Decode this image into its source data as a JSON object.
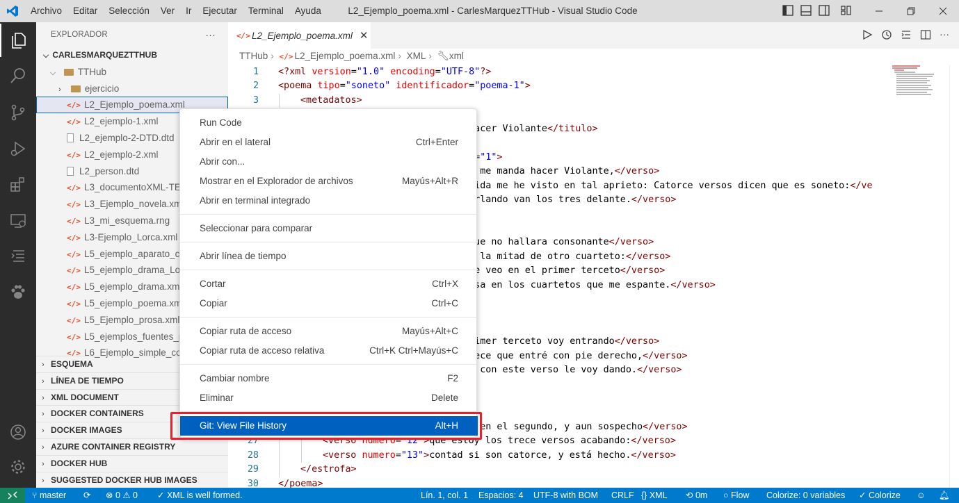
{
  "titlebar": {
    "menu": [
      "Archivo",
      "Editar",
      "Selección",
      "Ver",
      "Ir",
      "Ejecutar",
      "Terminal",
      "Ayuda"
    ],
    "window_title": "L2_Ejemplo_poema.xml - CarlesMarquezTTHub - Visual Studio Code"
  },
  "sidebar": {
    "title": "EXPLORADOR",
    "more": "···",
    "root": "CARLESMARQUEZTTHUB",
    "folder": "TTHub",
    "subfolder": "ejercicio",
    "files": [
      {
        "name": "L2_Ejemplo_poema.xml",
        "type": "xml"
      },
      {
        "name": "L2_ejemplo-1.xml",
        "type": "xml"
      },
      {
        "name": "L2_ejemplo-2-DTD.dtd",
        "type": "file"
      },
      {
        "name": "L2_ejemplo-2.xml",
        "type": "xml"
      },
      {
        "name": "L2_person.dtd",
        "type": "file"
      },
      {
        "name": "L3_documentoXML-TE",
        "type": "xml"
      },
      {
        "name": "L3_Ejemplo_novela.xm",
        "type": "xml"
      },
      {
        "name": "L3_mi_esquema.rng",
        "type": "xml"
      },
      {
        "name": "L3-Ejemplo_Lorca.xml",
        "type": "xml"
      },
      {
        "name": "L5_ejemplo_aparato_cu",
        "type": "xml"
      },
      {
        "name": "L5_ejemplo_drama_Lop",
        "type": "xml"
      },
      {
        "name": "L5_ejemplo_drama.xm",
        "type": "xml"
      },
      {
        "name": "L5_ejemplo_poema.xm",
        "type": "xml"
      },
      {
        "name": "L5_Ejemplo_prosa.xml",
        "type": "xml"
      },
      {
        "name": "L5_ejemplos_fuentes_p",
        "type": "xml"
      },
      {
        "name": "L6_Ejemplo_simple_co",
        "type": "xml"
      }
    ],
    "panels": [
      "ESQUEMA",
      "LÍNEA DE TIEMPO",
      "XML DOCUMENT",
      "DOCKER CONTAINERS",
      "DOCKER IMAGES",
      "AZURE CONTAINER REGISTRY",
      "DOCKER HUB",
      "SUGGESTED DOCKER HUB IMAGES"
    ]
  },
  "editor": {
    "tab_label": "L2_Ejemplo_poema.xml",
    "tab_close": "✕",
    "breadcrumb": [
      "TTHub",
      "L2_Ejemplo_poema.xml",
      "XML",
      "xml"
    ]
  },
  "code_lines": [
    {
      "n": "1",
      "indent": 0,
      "parts": [
        [
          "pi",
          "<?xml "
        ],
        [
          "attr",
          "version"
        ],
        [
          "txt",
          "="
        ],
        [
          "val",
          "\"1.0\""
        ],
        [
          "txt",
          " "
        ],
        [
          "attr",
          "encoding"
        ],
        [
          "txt",
          "="
        ],
        [
          "val",
          "\"UTF-8\""
        ],
        [
          "pi",
          "?>"
        ]
      ]
    },
    {
      "n": "2",
      "indent": 0,
      "parts": [
        [
          "tag",
          "<poema "
        ],
        [
          "attr",
          "tipo"
        ],
        [
          "txt",
          "="
        ],
        [
          "val",
          "\"soneto\""
        ],
        [
          "txt",
          " "
        ],
        [
          "attr",
          "identificador"
        ],
        [
          "txt",
          "="
        ],
        [
          "val",
          "\"poema-1\""
        ],
        [
          "tag",
          ">"
        ]
      ]
    },
    {
      "n": "3",
      "indent": 1,
      "parts": [
        [
          "tag",
          "<metadatos>"
        ]
      ]
    },
    {
      "n": "",
      "indent": 0,
      "parts": [
        [
          "txt",
          "                                  "
        ],
        [
          "tag",
          ">"
        ]
      ]
    },
    {
      "n": "",
      "indent": 0,
      "parts": [
        [
          "txt",
          "                                  hacer Violante"
        ],
        [
          "tag",
          "</titulo>"
        ]
      ]
    },
    {
      "n": "",
      "indent": 0,
      "parts": []
    },
    {
      "n": "",
      "indent": 0,
      "parts": [
        [
          "txt",
          "                                  "
        ],
        [
          "attr",
          "o"
        ],
        [
          "txt",
          "="
        ],
        [
          "val",
          "\"1\""
        ],
        [
          "tag",
          ">"
        ]
      ]
    },
    {
      "n": "",
      "indent": 0,
      "parts": [
        [
          "txt",
          "                                  o me manda hacer Violante,"
        ],
        [
          "tag",
          "</verso>"
        ]
      ]
    },
    {
      "n": "",
      "indent": 0,
      "parts": [
        [
          "txt",
          "                                  vida me he visto en tal aprieto: Catorce versos dicen que es soneto:"
        ],
        [
          "tag",
          "</ve"
        ]
      ]
    },
    {
      "n": "",
      "indent": 0,
      "parts": [
        [
          "txt",
          "                                  urlando van los tres delante."
        ],
        [
          "tag",
          "</verso>"
        ]
      ]
    },
    {
      "n": "",
      "indent": 0,
      "parts": []
    },
    {
      "n": "",
      "indent": 0,
      "parts": []
    },
    {
      "n": "",
      "indent": 0,
      "parts": [
        [
          "txt",
          "                                  que no hallara consonante"
        ],
        [
          "tag",
          "</verso>"
        ]
      ]
    },
    {
      "n": "",
      "indent": 0,
      "parts": [
        [
          "txt",
          "                                  a la mitad de otro cuarteto:"
        ],
        [
          "tag",
          "</verso>"
        ]
      ]
    },
    {
      "n": "",
      "indent": 0,
      "parts": [
        [
          "txt",
          "                                  me veo en el primer terceto"
        ],
        [
          "tag",
          "</verso>"
        ]
      ]
    },
    {
      "n": "",
      "indent": 0,
      "parts": [
        [
          "txt",
          "                                  osa en los cuartetos que me espante."
        ],
        [
          "tag",
          "</verso>"
        ]
      ]
    },
    {
      "n": "",
      "indent": 0,
      "parts": []
    },
    {
      "n": "",
      "indent": 0,
      "parts": []
    },
    {
      "n": "",
      "indent": 0,
      "parts": []
    },
    {
      "n": "",
      "indent": 0,
      "parts": [
        [
          "txt",
          "                                  rimer terceto voy entrando"
        ],
        [
          "tag",
          "</verso>"
        ]
      ]
    },
    {
      "n": "",
      "indent": 0,
      "parts": [
        [
          "txt",
          "                                  rece que entré con pie derecho,"
        ],
        [
          "tag",
          "</verso>"
        ]
      ]
    },
    {
      "n": "",
      "indent": 0,
      "parts": [
        [
          "txt",
          "                                  n con este verso le voy dando."
        ],
        [
          "tag",
          "</verso>"
        ]
      ]
    },
    {
      "n": "",
      "indent": 0,
      "parts": []
    },
    {
      "n": "",
      "indent": 0,
      "parts": []
    },
    {
      "n": "",
      "indent": 0,
      "parts": []
    },
    {
      "n": "",
      "indent": 0,
      "parts": [
        [
          "txt",
          "                                  y en el segundo, y aun sospecho"
        ],
        [
          "tag",
          "</verso>"
        ]
      ]
    },
    {
      "n": "27",
      "indent": 2,
      "parts": [
        [
          "tag",
          "<verso "
        ],
        [
          "attr",
          "numero"
        ],
        [
          "txt",
          "="
        ],
        [
          "val",
          "\"12\""
        ],
        [
          "tag",
          ">"
        ],
        [
          "txt",
          "que estoy los trece versos acabando:"
        ],
        [
          "tag",
          "</verso>"
        ]
      ]
    },
    {
      "n": "28",
      "indent": 2,
      "parts": [
        [
          "tag",
          "<verso "
        ],
        [
          "attr",
          "numero"
        ],
        [
          "txt",
          "="
        ],
        [
          "val",
          "\"13\""
        ],
        [
          "tag",
          ">"
        ],
        [
          "txt",
          "contad si son catorce, y está hecho."
        ],
        [
          "tag",
          "</verso>"
        ]
      ]
    },
    {
      "n": "29",
      "indent": 1,
      "parts": [
        [
          "tag",
          "</estrofa>"
        ]
      ]
    },
    {
      "n": "30",
      "indent": 0,
      "parts": [
        [
          "tag",
          "</poema>"
        ]
      ]
    }
  ],
  "context_menu": {
    "groups": [
      [
        {
          "label": "Run Code",
          "key": ""
        },
        {
          "label": "Abrir en el lateral",
          "key": "Ctrl+Enter"
        },
        {
          "label": "Abrir con...",
          "key": ""
        },
        {
          "label": "Mostrar en el Explorador de archivos",
          "key": "Mayús+Alt+R"
        },
        {
          "label": "Abrir en terminal integrado",
          "key": ""
        }
      ],
      [
        {
          "label": "Seleccionar para comparar",
          "key": ""
        }
      ],
      [
        {
          "label": "Abrir línea de tiempo",
          "key": ""
        }
      ],
      [
        {
          "label": "Cortar",
          "key": "Ctrl+X"
        },
        {
          "label": "Copiar",
          "key": "Ctrl+C"
        }
      ],
      [
        {
          "label": "Copiar ruta de acceso",
          "key": "Mayús+Alt+C"
        },
        {
          "label": "Copiar ruta de acceso relativa",
          "key": "Ctrl+K Ctrl+Mayús+C"
        }
      ],
      [
        {
          "label": "Cambiar nombre",
          "key": "F2"
        },
        {
          "label": "Eliminar",
          "key": "Delete"
        }
      ],
      [
        {
          "label": "Git: View File History",
          "key": "Alt+H",
          "highlighted": true
        }
      ]
    ]
  },
  "statusbar": {
    "branch": "master",
    "problems": "⊗ 0 ⚠ 0",
    "xml_status": "✓ XML is well formed.",
    "position": "Lín. 1, col. 1",
    "spaces": "Espacios: 4",
    "encoding": "UTF-8 with BOM",
    "eol": "CRLF",
    "language": "{} XML",
    "time": "0m",
    "flow": "Flow",
    "colorize": "Colorize: 0 variables",
    "colorize2": "✓ Colorize"
  },
  "colors": {
    "accent": "#007acc",
    "menu_highlight": "#0060c0",
    "red_box": "#e8202a"
  }
}
